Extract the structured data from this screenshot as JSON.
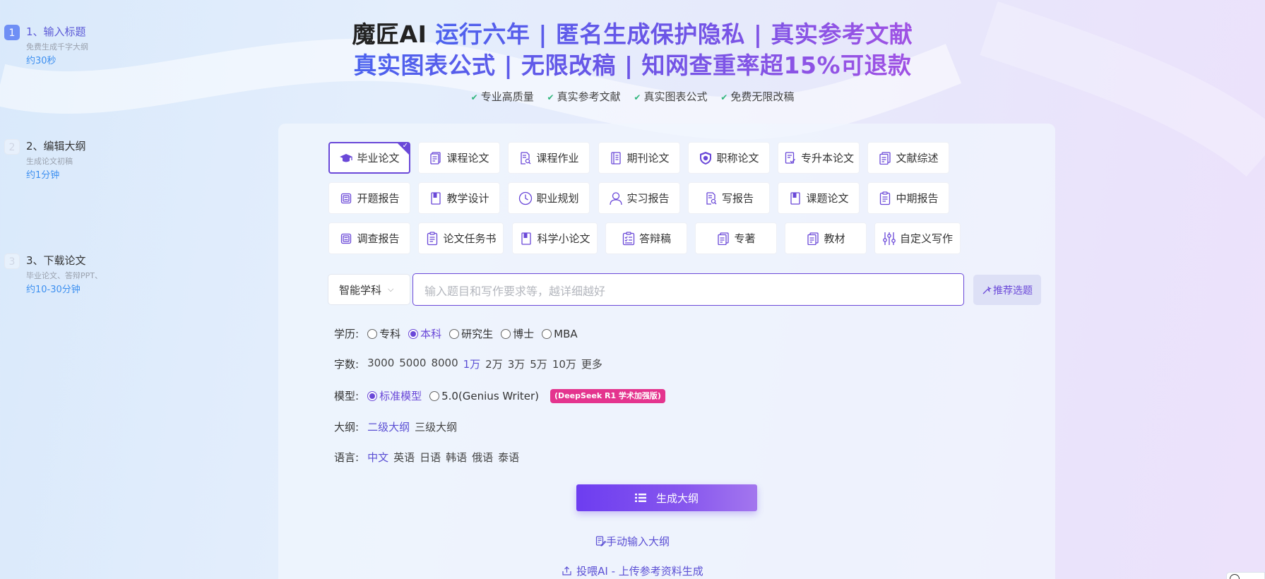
{
  "steps": [
    {
      "num": "1",
      "title": "1、输入标题",
      "desc": "免费生成千字大纲",
      "time": "约30秒"
    },
    {
      "num": "2",
      "title": "2、编辑大纲",
      "desc": "生成论文初稿",
      "time": "约1分钟"
    },
    {
      "num": "3",
      "title": "3、下载论文",
      "desc": "毕业论文、答辩PPT、",
      "time": "约10-30分钟"
    }
  ],
  "header": {
    "brand": "魔匠AI",
    "line1": " 运行六年 | 匿名生成保护隐私 | 真实参考文献",
    "line2": "真实图表公式 | 无限改稿 | 知网查重率超15%可退款",
    "features": [
      "专业高质量",
      "真实参考文献",
      "真实图表公式",
      "免费无限改稿"
    ]
  },
  "paper_types": [
    {
      "label": "毕业论文",
      "icon": "graduation-cap-icon"
    },
    {
      "label": "课程论文",
      "icon": "document-icon"
    },
    {
      "label": "课程作业",
      "icon": "document-search-icon"
    },
    {
      "label": "期刊论文",
      "icon": "journal-icon"
    },
    {
      "label": "职称论文",
      "icon": "shield-badge-icon"
    },
    {
      "label": "专升本论文",
      "icon": "document-check-icon"
    },
    {
      "label": "文献综述",
      "icon": "documents-icon"
    },
    {
      "label": "开题报告",
      "icon": "report-icon"
    },
    {
      "label": "教学设计",
      "icon": "book-icon"
    },
    {
      "label": "职业规划",
      "icon": "clock-icon"
    },
    {
      "label": "实习报告",
      "icon": "person-icon"
    },
    {
      "label": "写报告",
      "icon": "document-search-icon"
    },
    {
      "label": "课题论文",
      "icon": "book-icon"
    },
    {
      "label": "中期报告",
      "icon": "clipboard-icon"
    },
    {
      "label": "调查报告",
      "icon": "report-icon"
    },
    {
      "label": "论文任务书",
      "icon": "clipboard-icon"
    },
    {
      "label": "科学小论文",
      "icon": "book-icon"
    },
    {
      "label": "答辩稿",
      "icon": "checklist-icon"
    },
    {
      "label": "专著",
      "icon": "documents-icon"
    },
    {
      "label": "教材",
      "icon": "documents-icon"
    },
    {
      "label": "自定义写作",
      "icon": "sliders-icon"
    }
  ],
  "selected_type": "毕业论文",
  "subject_select": {
    "value": "智能学科"
  },
  "topic_input": {
    "placeholder": "输入题目和写作要求等，越详细越好",
    "value": ""
  },
  "recommend_button": "推荐选题",
  "options": {
    "degree": {
      "label": "学历:",
      "items": [
        "专科",
        "本科",
        "研究生",
        "博士",
        "MBA"
      ],
      "selected": "本科"
    },
    "words": {
      "label": "字数:",
      "items": [
        "3000",
        "5000",
        "8000",
        "1万",
        "2万",
        "3万",
        "5万",
        "10万",
        "更多"
      ],
      "selected": "1万"
    },
    "model": {
      "label": "模型:",
      "items": [
        "标准模型",
        "5.0(Genius Writer)"
      ],
      "selected": "标准模型",
      "badge": "(DeepSeek R1 学术加强版)"
    },
    "outline": {
      "label": "大纲:",
      "items": [
        "二级大纲",
        "三级大纲"
      ],
      "selected": "二级大纲"
    },
    "language": {
      "label": "语言:",
      "items": [
        "中文",
        "英语",
        "日语",
        "韩语",
        "俄语",
        "泰语"
      ],
      "selected": "中文"
    }
  },
  "generate_button": "生成大纲",
  "manual_link": "手动输入大纲",
  "upload_link": "投喂AI - 上传参考资料生成",
  "colors": {
    "accent": "#6a48d8",
    "badge": "#e4348e",
    "time": "#3c8ff0"
  }
}
